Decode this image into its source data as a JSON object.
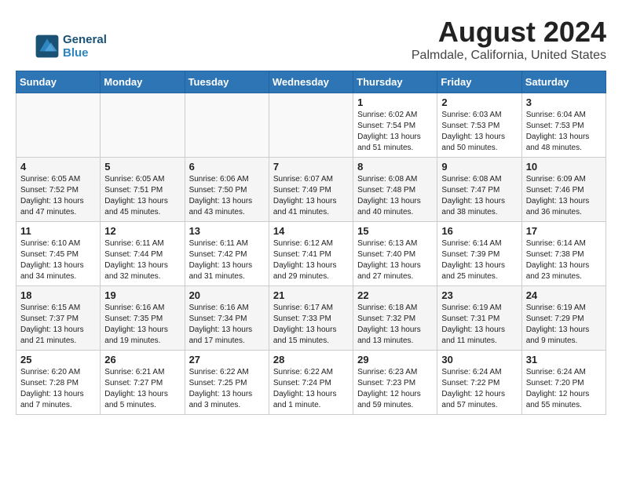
{
  "header": {
    "title": "August 2024",
    "subtitle": "Palmdale, California, United States",
    "logo_line1": "General",
    "logo_line2": "Blue"
  },
  "days_of_week": [
    "Sunday",
    "Monday",
    "Tuesday",
    "Wednesday",
    "Thursday",
    "Friday",
    "Saturday"
  ],
  "weeks": [
    [
      {
        "day": "",
        "info": ""
      },
      {
        "day": "",
        "info": ""
      },
      {
        "day": "",
        "info": ""
      },
      {
        "day": "",
        "info": ""
      },
      {
        "day": "1",
        "info": "Sunrise: 6:02 AM\nSunset: 7:54 PM\nDaylight: 13 hours\nand 51 minutes."
      },
      {
        "day": "2",
        "info": "Sunrise: 6:03 AM\nSunset: 7:53 PM\nDaylight: 13 hours\nand 50 minutes."
      },
      {
        "day": "3",
        "info": "Sunrise: 6:04 AM\nSunset: 7:53 PM\nDaylight: 13 hours\nand 48 minutes."
      }
    ],
    [
      {
        "day": "4",
        "info": "Sunrise: 6:05 AM\nSunset: 7:52 PM\nDaylight: 13 hours\nand 47 minutes."
      },
      {
        "day": "5",
        "info": "Sunrise: 6:05 AM\nSunset: 7:51 PM\nDaylight: 13 hours\nand 45 minutes."
      },
      {
        "day": "6",
        "info": "Sunrise: 6:06 AM\nSunset: 7:50 PM\nDaylight: 13 hours\nand 43 minutes."
      },
      {
        "day": "7",
        "info": "Sunrise: 6:07 AM\nSunset: 7:49 PM\nDaylight: 13 hours\nand 41 minutes."
      },
      {
        "day": "8",
        "info": "Sunrise: 6:08 AM\nSunset: 7:48 PM\nDaylight: 13 hours\nand 40 minutes."
      },
      {
        "day": "9",
        "info": "Sunrise: 6:08 AM\nSunset: 7:47 PM\nDaylight: 13 hours\nand 38 minutes."
      },
      {
        "day": "10",
        "info": "Sunrise: 6:09 AM\nSunset: 7:46 PM\nDaylight: 13 hours\nand 36 minutes."
      }
    ],
    [
      {
        "day": "11",
        "info": "Sunrise: 6:10 AM\nSunset: 7:45 PM\nDaylight: 13 hours\nand 34 minutes."
      },
      {
        "day": "12",
        "info": "Sunrise: 6:11 AM\nSunset: 7:44 PM\nDaylight: 13 hours\nand 32 minutes."
      },
      {
        "day": "13",
        "info": "Sunrise: 6:11 AM\nSunset: 7:42 PM\nDaylight: 13 hours\nand 31 minutes."
      },
      {
        "day": "14",
        "info": "Sunrise: 6:12 AM\nSunset: 7:41 PM\nDaylight: 13 hours\nand 29 minutes."
      },
      {
        "day": "15",
        "info": "Sunrise: 6:13 AM\nSunset: 7:40 PM\nDaylight: 13 hours\nand 27 minutes."
      },
      {
        "day": "16",
        "info": "Sunrise: 6:14 AM\nSunset: 7:39 PM\nDaylight: 13 hours\nand 25 minutes."
      },
      {
        "day": "17",
        "info": "Sunrise: 6:14 AM\nSunset: 7:38 PM\nDaylight: 13 hours\nand 23 minutes."
      }
    ],
    [
      {
        "day": "18",
        "info": "Sunrise: 6:15 AM\nSunset: 7:37 PM\nDaylight: 13 hours\nand 21 minutes."
      },
      {
        "day": "19",
        "info": "Sunrise: 6:16 AM\nSunset: 7:35 PM\nDaylight: 13 hours\nand 19 minutes."
      },
      {
        "day": "20",
        "info": "Sunrise: 6:16 AM\nSunset: 7:34 PM\nDaylight: 13 hours\nand 17 minutes."
      },
      {
        "day": "21",
        "info": "Sunrise: 6:17 AM\nSunset: 7:33 PM\nDaylight: 13 hours\nand 15 minutes."
      },
      {
        "day": "22",
        "info": "Sunrise: 6:18 AM\nSunset: 7:32 PM\nDaylight: 13 hours\nand 13 minutes."
      },
      {
        "day": "23",
        "info": "Sunrise: 6:19 AM\nSunset: 7:31 PM\nDaylight: 13 hours\nand 11 minutes."
      },
      {
        "day": "24",
        "info": "Sunrise: 6:19 AM\nSunset: 7:29 PM\nDaylight: 13 hours\nand 9 minutes."
      }
    ],
    [
      {
        "day": "25",
        "info": "Sunrise: 6:20 AM\nSunset: 7:28 PM\nDaylight: 13 hours\nand 7 minutes."
      },
      {
        "day": "26",
        "info": "Sunrise: 6:21 AM\nSunset: 7:27 PM\nDaylight: 13 hours\nand 5 minutes."
      },
      {
        "day": "27",
        "info": "Sunrise: 6:22 AM\nSunset: 7:25 PM\nDaylight: 13 hours\nand 3 minutes."
      },
      {
        "day": "28",
        "info": "Sunrise: 6:22 AM\nSunset: 7:24 PM\nDaylight: 13 hours\nand 1 minute."
      },
      {
        "day": "29",
        "info": "Sunrise: 6:23 AM\nSunset: 7:23 PM\nDaylight: 12 hours\nand 59 minutes."
      },
      {
        "day": "30",
        "info": "Sunrise: 6:24 AM\nSunset: 7:22 PM\nDaylight: 12 hours\nand 57 minutes."
      },
      {
        "day": "31",
        "info": "Sunrise: 6:24 AM\nSunset: 7:20 PM\nDaylight: 12 hours\nand 55 minutes."
      }
    ]
  ]
}
